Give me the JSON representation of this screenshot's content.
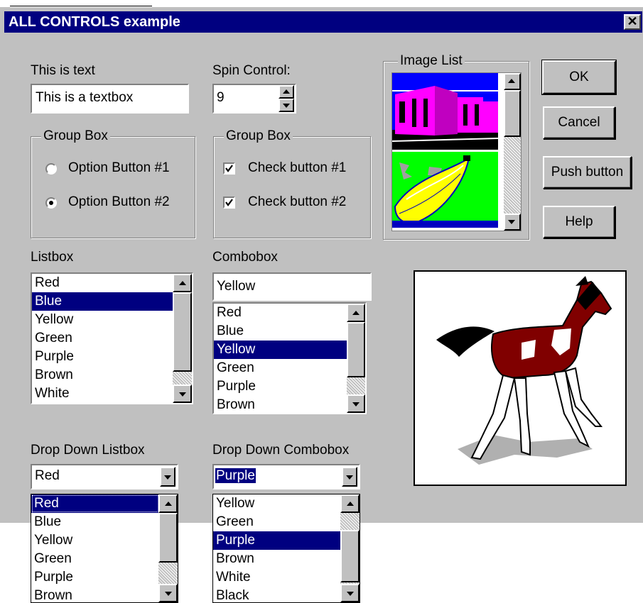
{
  "window": {
    "title": "ALL CONTROLS example",
    "close_glyph": "✕"
  },
  "text_label": "This is text",
  "textbox_value": "This is a textbox",
  "spin": {
    "label": "Spin Control:",
    "value": "9"
  },
  "image_list": {
    "label": "Image List"
  },
  "buttons": {
    "ok": "OK",
    "cancel": "Cancel",
    "push": "Push button",
    "help": "Help"
  },
  "group_radio": {
    "title": "Group Box",
    "option1": "Option Button #1",
    "option2": "Option Button #2",
    "selected": 2
  },
  "group_check": {
    "title": "Group Box",
    "check1": "Check button #1",
    "check2": "Check button #2",
    "checked1": true,
    "checked2": true
  },
  "listbox": {
    "label": "Listbox",
    "items": [
      "Red",
      "Blue",
      "Yellow",
      "Green",
      "Purple",
      "Brown",
      "White"
    ],
    "selected": "Blue"
  },
  "combobox": {
    "label": "Combobox",
    "value": "Yellow",
    "items": [
      "Red",
      "Blue",
      "Yellow",
      "Green",
      "Purple",
      "Brown"
    ],
    "selected": "Yellow"
  },
  "dd_listbox": {
    "label": "Drop Down Listbox",
    "value": "Red",
    "items": [
      "Red",
      "Blue",
      "Yellow",
      "Green",
      "Purple",
      "Brown"
    ],
    "selected": "Red"
  },
  "dd_combobox": {
    "label": "Drop Down Combobox",
    "value": "Purple",
    "items": [
      "Yellow",
      "Green",
      "Purple",
      "Brown",
      "White",
      "Black"
    ],
    "selected": "Purple"
  },
  "icons": {
    "close": "close-icon",
    "spin_up": "arrow-up-icon",
    "spin_down": "arrow-down-icon",
    "dropdown": "chevron-down-icon",
    "horse": "horse-picture",
    "city": "city-picture",
    "bananas": "bananas-picture"
  },
  "colors": {
    "titlebar": "#000080",
    "face": "#c0c0c0",
    "selection": "#000080"
  }
}
